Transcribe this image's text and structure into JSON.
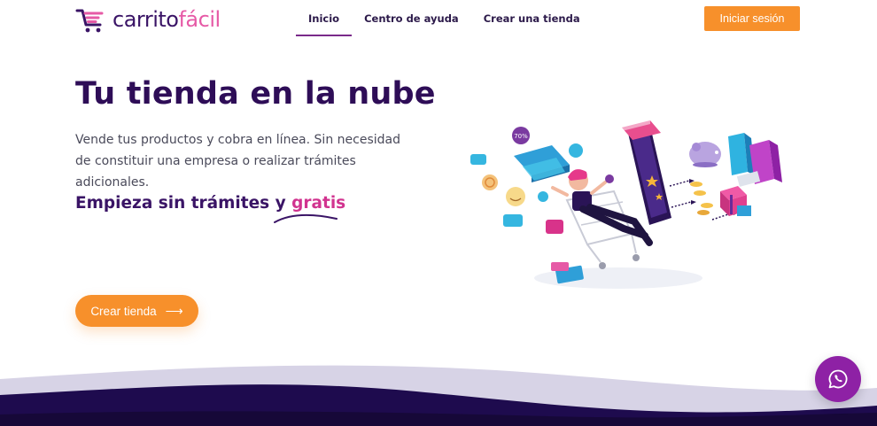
{
  "brand": {
    "name_part1": "carrito",
    "name_part2": "fácil",
    "primary_color": "#3a1466",
    "accent_color": "#e65aa6"
  },
  "nav": {
    "items": [
      {
        "label": "Inicio",
        "active": true
      },
      {
        "label": "Centro de ayuda",
        "active": false
      },
      {
        "label": "Crear una tienda",
        "active": false
      }
    ]
  },
  "header": {
    "login_label": "Iniciar sesión",
    "login_color": "#f7902b"
  },
  "hero": {
    "title": "Tu tienda en la nube",
    "description": "Vende tus productos y cobra en línea. Sin necesidad de constituir una empresa o realizar trámites adicionales.",
    "subtitle_main": "Empieza sin trámites y ",
    "subtitle_highlight": "gratis",
    "cta_label": "Crear tienda",
    "cta_icon": "arrow-right-icon"
  },
  "illustration": {
    "badge_text": "70%"
  },
  "whatsapp": {
    "icon": "whatsapp-icon",
    "color": "#8e21a5"
  }
}
